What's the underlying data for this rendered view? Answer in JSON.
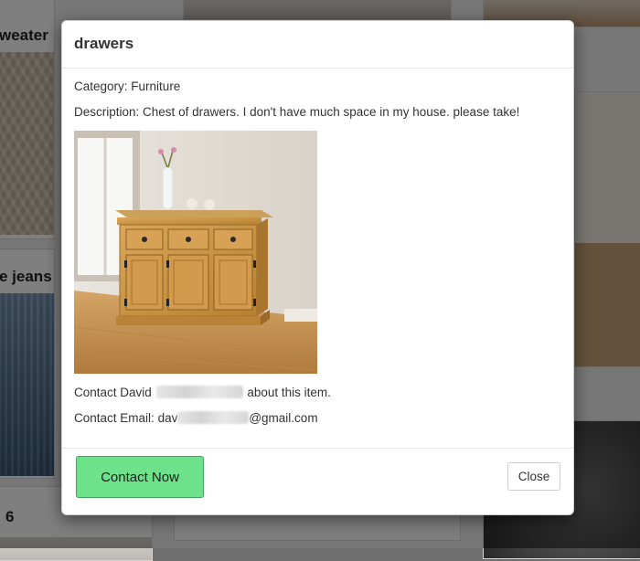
{
  "background": {
    "card_titles": [
      "weater",
      "e jeans",
      "6"
    ]
  },
  "modal": {
    "title": "drawers",
    "category_label": "Category:",
    "category": "Furniture",
    "description_label": "Description:",
    "description": "Chest of drawers. I don't have much space in my house. please take!",
    "image_icon": "chest-of-drawers-photo",
    "contact_prefix": "Contact David",
    "contact_suffix": "about this item.",
    "email_label": "Contact Email:",
    "email_start": "dav",
    "email_end": "@gmail.com",
    "contact_now_label": "Contact Now",
    "close_label": "Close"
  },
  "colors": {
    "contact_button": "#6ee28a",
    "overlay": "#000000"
  }
}
